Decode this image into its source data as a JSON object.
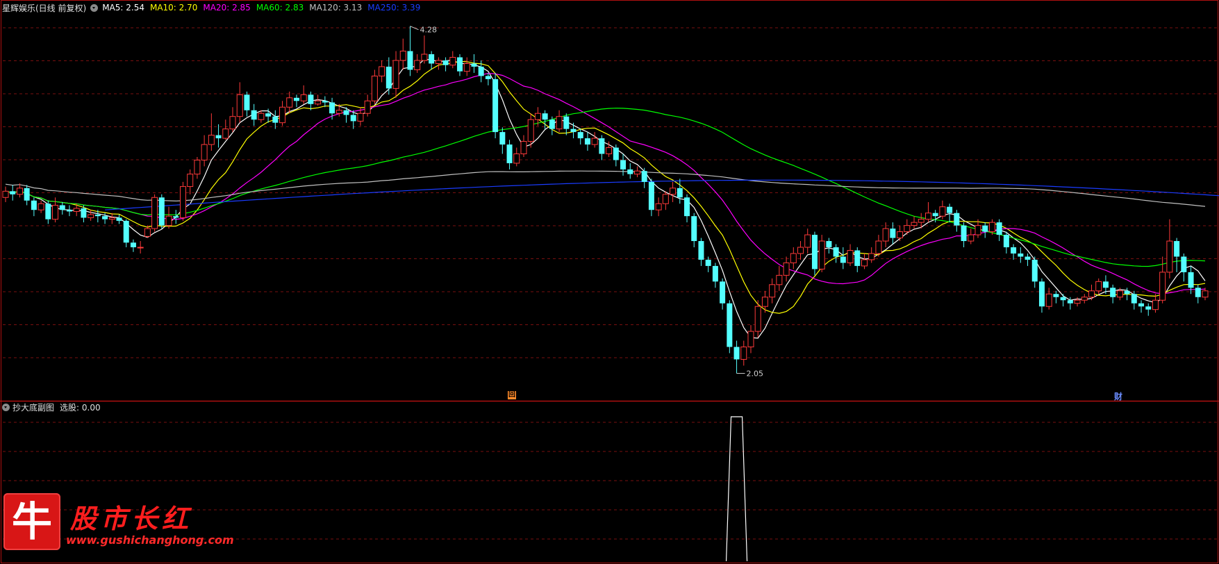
{
  "main_chart": {
    "title": "星辉娱乐(日线 前复权)",
    "legend": [
      {
        "label": "MA5",
        "value": "2.54",
        "color": "#ffffff"
      },
      {
        "label": "MA10",
        "value": "2.70",
        "color": "#ffff00"
      },
      {
        "label": "MA20",
        "value": "2.85",
        "color": "#ff00ff"
      },
      {
        "label": "MA60",
        "value": "2.83",
        "color": "#00ff00"
      },
      {
        "label": "MA120",
        "value": "3.13",
        "color": "#c0c0c0"
      },
      {
        "label": "MA250",
        "value": "3.39",
        "color": "#1a3cff"
      }
    ],
    "high_label": "4.28",
    "low_label": "2.05",
    "marker_hui": "回",
    "marker_cai": "财"
  },
  "sub_chart": {
    "title": "抄大底副图",
    "indicator_label": "选股: 0.00"
  },
  "watermark": {
    "logo_char": "牛",
    "brand_text": "股市长红",
    "url": "www.gushichanghong.com"
  },
  "colors": {
    "up": "#ff3a3a",
    "down": "#54ffff",
    "grid": "#7a1010",
    "border": "#b01010"
  },
  "chart_data": {
    "type": "candlestick",
    "y_range": [
      1.95,
      4.35
    ],
    "high": 4.28,
    "low": 2.05,
    "candles": [
      [
        3.18,
        3.22,
        3.15,
        3.25
      ],
      [
        3.22,
        3.2,
        3.16,
        3.26
      ],
      [
        3.2,
        3.24,
        3.18,
        3.27
      ],
      [
        3.24,
        3.16,
        3.13,
        3.26
      ],
      [
        3.16,
        3.1,
        3.06,
        3.18
      ],
      [
        3.1,
        3.14,
        3.08,
        3.16
      ],
      [
        3.14,
        3.04,
        3.01,
        3.16
      ],
      [
        3.04,
        3.13,
        3.02,
        3.18
      ],
      [
        3.13,
        3.1,
        3.07,
        3.15
      ],
      [
        3.1,
        3.09,
        3.06,
        3.13
      ],
      [
        3.09,
        3.11,
        3.06,
        3.14
      ],
      [
        3.11,
        3.05,
        3.02,
        3.13
      ],
      [
        3.05,
        3.07,
        3.03,
        3.1
      ],
      [
        3.07,
        3.06,
        3.02,
        3.1
      ],
      [
        3.06,
        3.04,
        3.01,
        3.08
      ],
      [
        3.04,
        3.05,
        3.01,
        3.08
      ],
      [
        3.05,
        3.03,
        3.01,
        3.07
      ],
      [
        3.03,
        2.89,
        2.86,
        3.04
      ],
      [
        2.89,
        2.86,
        2.83,
        2.91
      ],
      [
        2.86,
        2.86,
        2.82,
        2.9
      ],
      [
        2.93,
        2.98,
        2.92,
        3.0
      ],
      [
        2.98,
        3.18,
        2.96,
        3.2
      ],
      [
        3.18,
        3.0,
        2.98,
        3.2
      ],
      [
        3.0,
        3.06,
        2.98,
        3.12
      ],
      [
        3.06,
        3.05,
        3.01,
        3.1
      ],
      [
        3.05,
        3.25,
        3.03,
        3.28
      ],
      [
        3.25,
        3.33,
        3.2,
        3.36
      ],
      [
        3.33,
        3.42,
        3.3,
        3.44
      ],
      [
        3.42,
        3.52,
        3.38,
        3.58
      ],
      [
        3.52,
        3.58,
        3.48,
        3.72
      ],
      [
        3.58,
        3.56,
        3.5,
        3.65
      ],
      [
        3.56,
        3.62,
        3.55,
        3.68
      ],
      [
        3.62,
        3.7,
        3.6,
        3.76
      ],
      [
        3.7,
        3.84,
        3.66,
        3.92
      ],
      [
        3.84,
        3.74,
        3.7,
        3.86
      ],
      [
        3.74,
        3.68,
        3.64,
        3.78
      ],
      [
        3.68,
        3.72,
        3.66,
        3.74
      ],
      [
        3.72,
        3.7,
        3.66,
        3.75
      ],
      [
        3.7,
        3.66,
        3.62,
        3.74
      ],
      [
        3.66,
        3.76,
        3.64,
        3.8
      ],
      [
        3.76,
        3.82,
        3.72,
        3.86
      ],
      [
        3.82,
        3.8,
        3.76,
        3.84
      ],
      [
        3.8,
        3.84,
        3.78,
        3.9
      ],
      [
        3.84,
        3.78,
        3.74,
        3.86
      ],
      [
        3.78,
        3.8,
        3.77,
        3.84
      ],
      [
        3.8,
        3.79,
        3.76,
        3.83
      ],
      [
        3.79,
        3.72,
        3.68,
        3.82
      ],
      [
        3.72,
        3.74,
        3.7,
        3.78
      ],
      [
        3.74,
        3.71,
        3.66,
        3.76
      ],
      [
        3.71,
        3.67,
        3.62,
        3.74
      ],
      [
        3.67,
        3.72,
        3.64,
        3.76
      ],
      [
        3.72,
        3.8,
        3.7,
        3.84
      ],
      [
        3.8,
        3.96,
        3.78,
        4.0
      ],
      [
        3.96,
        4.02,
        3.92,
        4.06
      ],
      [
        4.02,
        3.88,
        3.84,
        4.08
      ],
      [
        3.88,
        4.06,
        3.82,
        4.12
      ],
      [
        4.06,
        4.12,
        4.0,
        4.2
      ],
      [
        4.12,
        4.0,
        3.96,
        4.28
      ],
      [
        4.0,
        4.06,
        3.98,
        4.1
      ],
      [
        4.06,
        4.1,
        4.04,
        4.22
      ],
      [
        4.1,
        4.04,
        4.0,
        4.12
      ],
      [
        4.04,
        4.06,
        4.0,
        4.08
      ],
      [
        4.06,
        4.03,
        3.99,
        4.08
      ],
      [
        4.03,
        4.08,
        4.01,
        4.12
      ],
      [
        4.08,
        3.99,
        3.96,
        4.1
      ],
      [
        3.99,
        4.04,
        3.96,
        4.08
      ],
      [
        4.04,
        4.02,
        3.98,
        4.1
      ],
      [
        4.02,
        3.96,
        3.92,
        4.06
      ],
      [
        3.96,
        3.94,
        3.9,
        3.98
      ],
      [
        3.94,
        3.6,
        3.56,
        3.98
      ],
      [
        3.6,
        3.52,
        3.46,
        3.63
      ],
      [
        3.52,
        3.4,
        3.36,
        3.55
      ],
      [
        3.4,
        3.46,
        3.38,
        3.5
      ],
      [
        3.46,
        3.54,
        3.44,
        3.58
      ],
      [
        3.54,
        3.68,
        3.5,
        3.72
      ],
      [
        3.68,
        3.72,
        3.64,
        3.76
      ],
      [
        3.72,
        3.68,
        3.62,
        3.74
      ],
      [
        3.68,
        3.62,
        3.58,
        3.7
      ],
      [
        3.62,
        3.7,
        3.6,
        3.74
      ],
      [
        3.7,
        3.62,
        3.58,
        3.72
      ],
      [
        3.62,
        3.6,
        3.56,
        3.66
      ],
      [
        3.6,
        3.56,
        3.52,
        3.62
      ],
      [
        3.56,
        3.52,
        3.48,
        3.6
      ],
      [
        3.52,
        3.56,
        3.5,
        3.6
      ],
      [
        3.56,
        3.46,
        3.42,
        3.58
      ],
      [
        3.46,
        3.5,
        3.44,
        3.54
      ],
      [
        3.5,
        3.42,
        3.38,
        3.52
      ],
      [
        3.42,
        3.36,
        3.32,
        3.46
      ],
      [
        3.36,
        3.33,
        3.3,
        3.4
      ],
      [
        3.33,
        3.35,
        3.31,
        3.38
      ],
      [
        3.35,
        3.28,
        3.24,
        3.37
      ],
      [
        3.28,
        3.1,
        3.06,
        3.3
      ],
      [
        3.1,
        3.14,
        3.06,
        3.18
      ],
      [
        3.14,
        3.2,
        3.1,
        3.22
      ],
      [
        3.2,
        3.24,
        3.15,
        3.28
      ],
      [
        3.24,
        3.18,
        3.14,
        3.3
      ],
      [
        3.18,
        3.06,
        3.02,
        3.2
      ],
      [
        3.06,
        2.9,
        2.86,
        3.08
      ],
      [
        2.9,
        2.78,
        2.74,
        2.92
      ],
      [
        2.78,
        2.74,
        2.7,
        2.8
      ],
      [
        2.74,
        2.64,
        2.6,
        2.76
      ],
      [
        2.64,
        2.5,
        2.46,
        2.66
      ],
      [
        2.5,
        2.22,
        2.18,
        2.52
      ],
      [
        2.22,
        2.14,
        2.05,
        2.26
      ],
      [
        2.14,
        2.22,
        2.1,
        2.26
      ],
      [
        2.22,
        2.32,
        2.18,
        2.36
      ],
      [
        2.32,
        2.48,
        2.28,
        2.52
      ],
      [
        2.48,
        2.54,
        2.44,
        2.58
      ],
      [
        2.54,
        2.62,
        2.5,
        2.66
      ],
      [
        2.62,
        2.68,
        2.58,
        2.74
      ],
      [
        2.68,
        2.76,
        2.64,
        2.8
      ],
      [
        2.76,
        2.82,
        2.72,
        2.86
      ],
      [
        2.82,
        2.86,
        2.78,
        2.9
      ],
      [
        2.86,
        2.94,
        2.82,
        2.98
      ],
      [
        2.94,
        2.72,
        2.68,
        2.96
      ],
      [
        2.72,
        2.9,
        2.7,
        2.94
      ],
      [
        2.9,
        2.86,
        2.82,
        2.92
      ],
      [
        2.86,
        2.8,
        2.76,
        2.88
      ],
      [
        2.8,
        2.76,
        2.72,
        2.86
      ],
      [
        2.76,
        2.84,
        2.74,
        2.88
      ],
      [
        2.84,
        2.74,
        2.7,
        2.86
      ],
      [
        2.74,
        2.78,
        2.72,
        2.82
      ],
      [
        2.78,
        2.82,
        2.76,
        2.86
      ],
      [
        2.82,
        2.9,
        2.8,
        2.94
      ],
      [
        2.9,
        2.98,
        2.86,
        3.02
      ],
      [
        2.98,
        2.92,
        2.88,
        3.02
      ],
      [
        2.92,
        2.96,
        2.9,
        3.0
      ],
      [
        2.96,
        3.0,
        2.94,
        3.04
      ],
      [
        3.0,
        3.02,
        2.98,
        3.06
      ],
      [
        3.02,
        3.04,
        2.98,
        3.08
      ],
      [
        3.04,
        3.08,
        3.02,
        3.15
      ],
      [
        3.08,
        3.06,
        3.02,
        3.1
      ],
      [
        3.06,
        3.12,
        3.04,
        3.16
      ],
      [
        3.12,
        3.08,
        3.02,
        3.14
      ],
      [
        3.08,
        3.0,
        2.96,
        3.1
      ],
      [
        3.0,
        2.9,
        2.86,
        3.02
      ],
      [
        2.9,
        2.94,
        2.88,
        2.98
      ],
      [
        2.94,
        3.0,
        2.92,
        3.04
      ],
      [
        3.0,
        2.96,
        2.92,
        3.02
      ],
      [
        2.96,
        3.02,
        2.94,
        3.04
      ],
      [
        3.02,
        2.94,
        2.9,
        3.04
      ],
      [
        2.94,
        2.86,
        2.82,
        2.96
      ],
      [
        2.86,
        2.82,
        2.78,
        2.88
      ],
      [
        2.82,
        2.8,
        2.76,
        2.86
      ],
      [
        2.8,
        2.78,
        2.74,
        2.82
      ],
      [
        2.78,
        2.64,
        2.6,
        2.8
      ],
      [
        2.64,
        2.48,
        2.44,
        2.66
      ],
      [
        2.48,
        2.56,
        2.46,
        2.6
      ],
      [
        2.56,
        2.54,
        2.5,
        2.58
      ],
      [
        2.54,
        2.52,
        2.48,
        2.56
      ],
      [
        2.52,
        2.5,
        2.46,
        2.54
      ],
      [
        2.5,
        2.52,
        2.48,
        2.54
      ],
      [
        2.52,
        2.54,
        2.5,
        2.56
      ],
      [
        2.54,
        2.58,
        2.52,
        2.62
      ],
      [
        2.58,
        2.64,
        2.56,
        2.66
      ],
      [
        2.64,
        2.6,
        2.56,
        2.68
      ],
      [
        2.6,
        2.54,
        2.5,
        2.62
      ],
      [
        2.54,
        2.58,
        2.52,
        2.6
      ],
      [
        2.58,
        2.56,
        2.52,
        2.6
      ],
      [
        2.56,
        2.5,
        2.46,
        2.58
      ],
      [
        2.5,
        2.48,
        2.44,
        2.52
      ],
      [
        2.48,
        2.46,
        2.42,
        2.5
      ],
      [
        2.46,
        2.52,
        2.44,
        2.56
      ],
      [
        2.52,
        2.7,
        2.5,
        2.8
      ],
      [
        2.7,
        2.9,
        2.66,
        3.04
      ],
      [
        2.9,
        2.8,
        2.7,
        2.92
      ],
      [
        2.8,
        2.7,
        2.64,
        2.82
      ],
      [
        2.7,
        2.6,
        2.56,
        2.74
      ],
      [
        2.6,
        2.54,
        2.5,
        2.62
      ],
      [
        2.54,
        2.58,
        2.52,
        2.6
      ]
    ],
    "sub_spike": {
      "indicator": "选股",
      "value": 0.0,
      "spike_index": 103,
      "spike_value": 1
    }
  }
}
